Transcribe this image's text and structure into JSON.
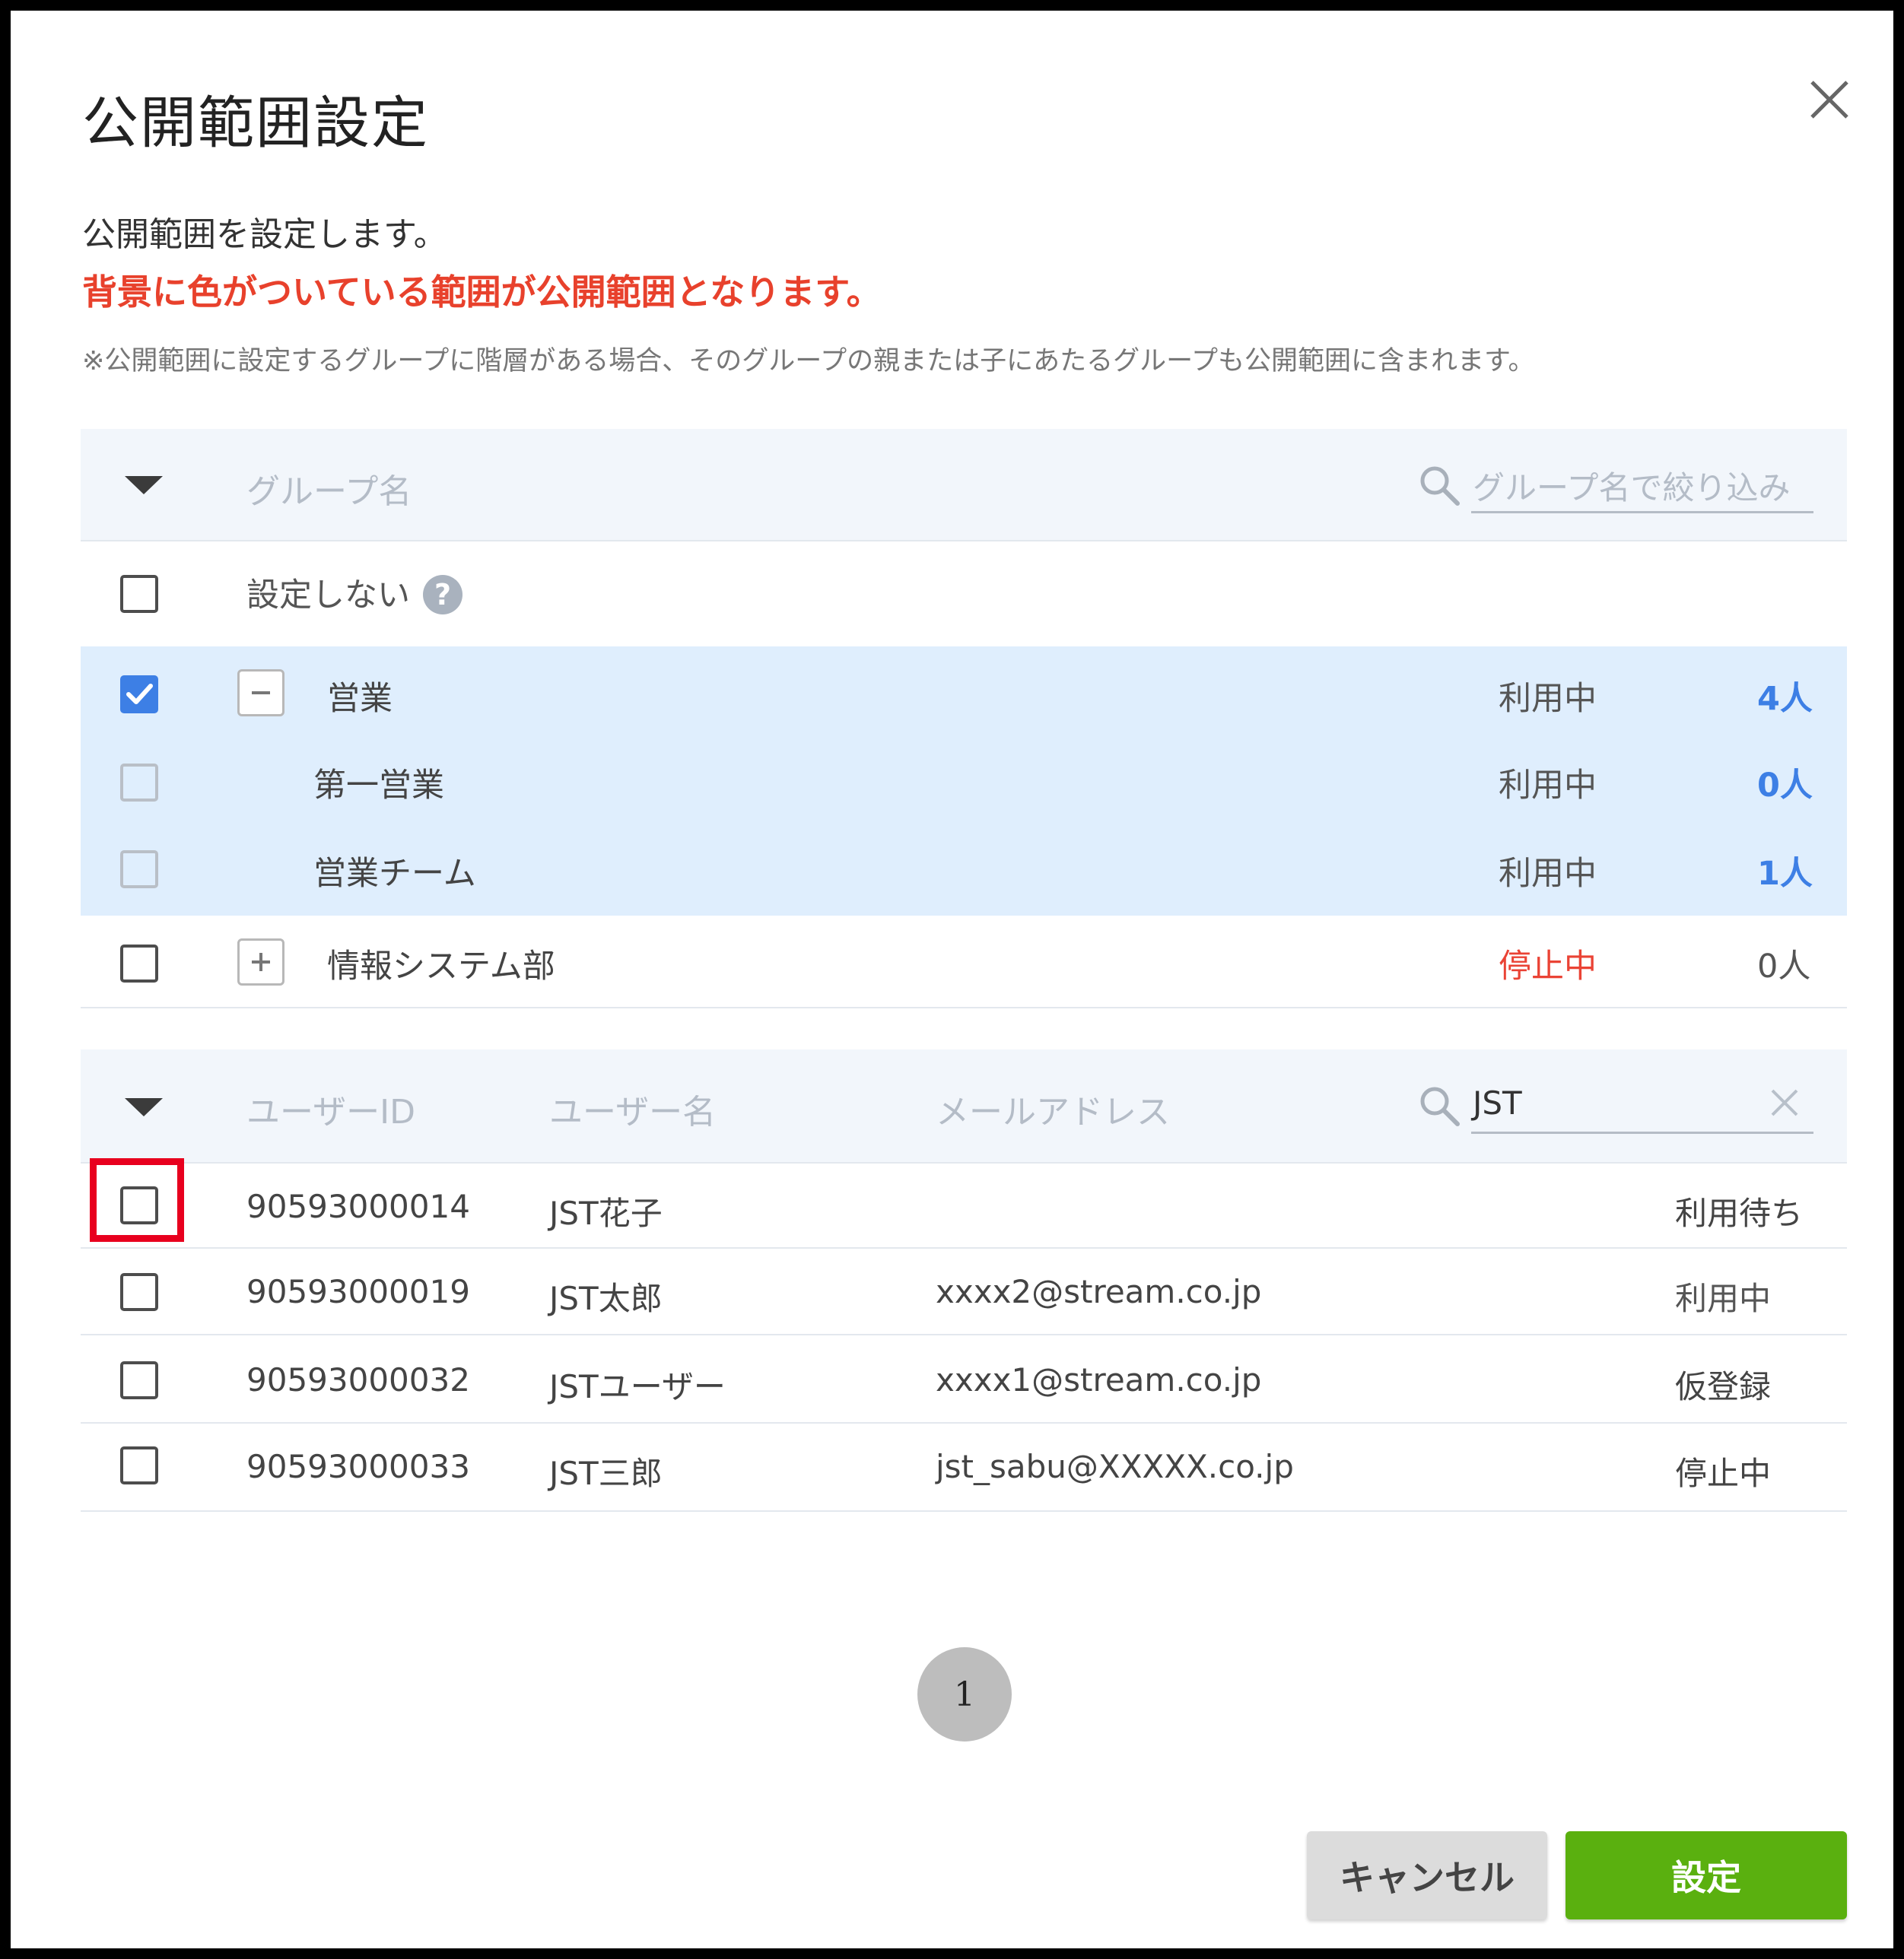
{
  "dialog": {
    "title": "公開範囲設定",
    "description": "公開範囲を設定します。",
    "highlight_notice": "背景に色がついている範囲が公開範囲となります。",
    "note": "※公開範囲に設定するグループに階層がある場合、そのグループの親または子にあたるグループも公開範囲に含まれます。"
  },
  "groups": {
    "header_label": "グループ名",
    "search_placeholder": "グループ名で絞り込み",
    "search_value": "",
    "none_option": {
      "label": "設定しない",
      "checked": false
    },
    "rows": [
      {
        "name": "営業",
        "status": "利用中",
        "count": "4人",
        "checked": true,
        "expander": "minus"
      },
      {
        "name": "第一営業",
        "status": "利用中",
        "count": "0人",
        "checked": false,
        "expander": ""
      },
      {
        "name": "営業チーム",
        "status": "利用中",
        "count": "1人",
        "checked": false,
        "expander": ""
      },
      {
        "name": "情報システム部",
        "status": "停止中",
        "count": "0人",
        "checked": false,
        "expander": "plus"
      }
    ]
  },
  "users": {
    "columns": {
      "user_id": "ユーザーID",
      "user_name": "ユーザー名",
      "email": "メールアドレス"
    },
    "search_value": "JST",
    "rows": [
      {
        "user_id": "90593000014",
        "user_name": "JST花子",
        "email": "",
        "status": "利用待ち",
        "checked": false
      },
      {
        "user_id": "90593000019",
        "user_name": "JST太郎",
        "email": "xxxx2@stream.co.jp",
        "status": "利用中",
        "checked": false
      },
      {
        "user_id": "90593000032",
        "user_name": "JSTユーザー",
        "email": "xxxx1@stream.co.jp",
        "status": "仮登録",
        "checked": false
      },
      {
        "user_id": "90593000033",
        "user_name": "JST三郎",
        "email": "jst_sabu@XXXXX.co.jp",
        "status": "停止中",
        "checked": false
      }
    ]
  },
  "pagination": {
    "current_page": "1"
  },
  "buttons": {
    "cancel_label": "キャンセル",
    "submit_label": "設定"
  },
  "colors": {
    "accent_blue": "#3d7fe5",
    "warning_red": "#ea4335",
    "highlight_bg": "#dfeefd",
    "submit_green": "#5ab00f",
    "annotation_red": "#e8001e"
  }
}
